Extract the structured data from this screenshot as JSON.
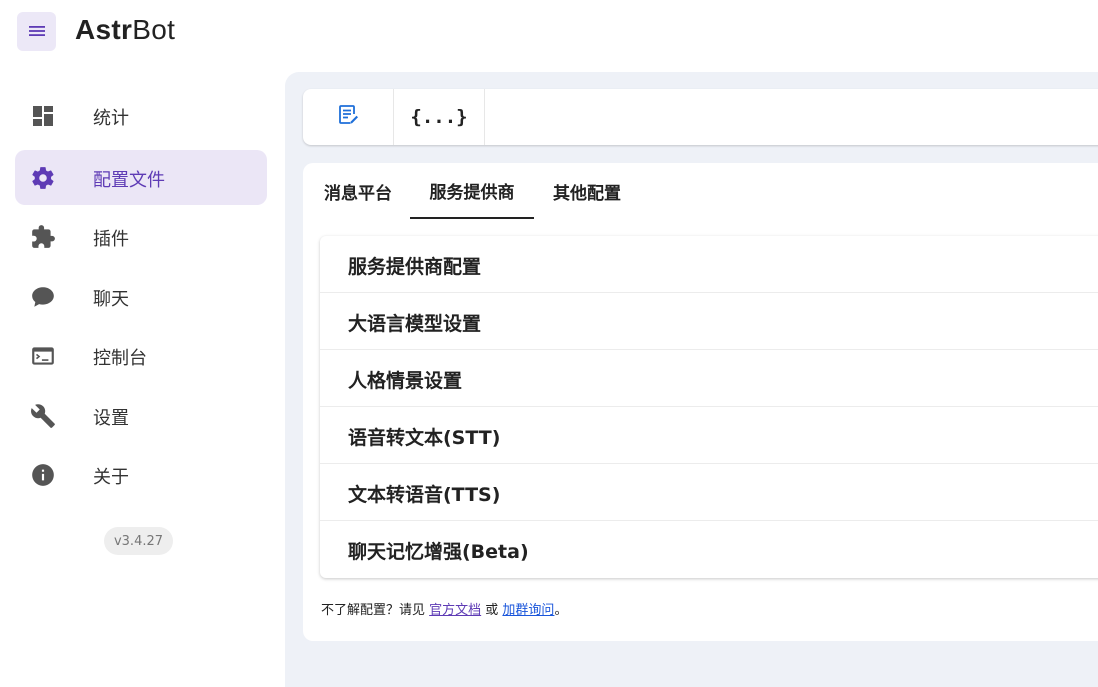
{
  "app": {
    "logo_bold": "Astr",
    "logo_thin": "Bot"
  },
  "sidebar": {
    "items": [
      {
        "label": "统计",
        "icon": "dashboard-icon",
        "active": false
      },
      {
        "label": "配置文件",
        "icon": "gear-icon",
        "active": true
      },
      {
        "label": "插件",
        "icon": "puzzle-icon",
        "active": false
      },
      {
        "label": "聊天",
        "icon": "chat-bubble-icon",
        "active": false
      },
      {
        "label": "控制台",
        "icon": "terminal-icon",
        "active": false
      },
      {
        "label": "设置",
        "icon": "wrench-icon",
        "active": false
      },
      {
        "label": "关于",
        "icon": "info-icon",
        "active": false
      }
    ],
    "version": "v3.4.27"
  },
  "toolbar": {
    "buttons": [
      {
        "icon": "edit-document-icon"
      },
      {
        "icon": "json-braces-icon",
        "label": "{...}"
      }
    ]
  },
  "tabs": [
    {
      "label": "消息平台",
      "active": false
    },
    {
      "label": "服务提供商",
      "active": true
    },
    {
      "label": "其他配置",
      "active": false
    }
  ],
  "panels": [
    {
      "title": "服务提供商配置"
    },
    {
      "title": "大语言模型设置"
    },
    {
      "title": "人格情景设置"
    },
    {
      "title": "语音转文本(STT)"
    },
    {
      "title": "文本转语音(TTS)"
    },
    {
      "title": "聊天记忆增强(Beta)"
    }
  ],
  "footnote": {
    "prefix": "不了解配置？请见 ",
    "doc_link": "官方文档",
    "middle": " 或 ",
    "group_link": "加群询问",
    "suffix": "。"
  },
  "colors": {
    "accent": "#5e3bb5",
    "active_bg": "#ebe6f6",
    "main_bg": "#eef1f7",
    "icon_grey": "#555555",
    "edit_icon_blue": "#1e6fd9"
  }
}
